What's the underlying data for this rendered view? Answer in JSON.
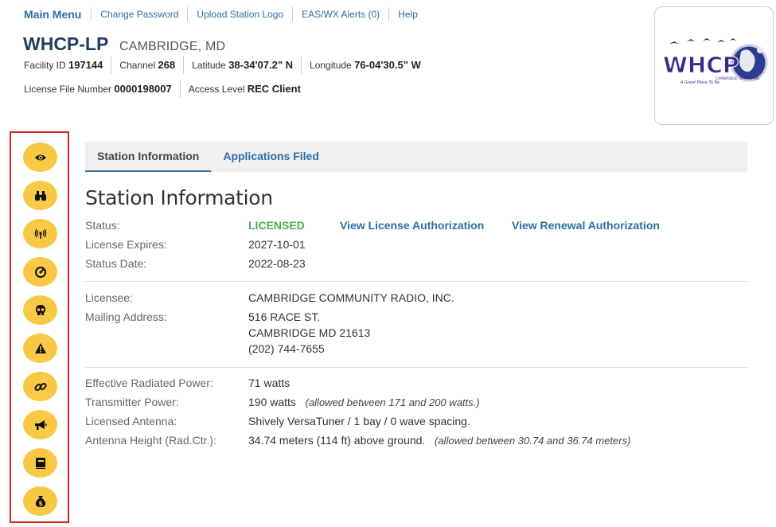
{
  "nav": {
    "main_menu": "Main Menu",
    "change_password": "Change Password",
    "upload_logo": "Upload Station Logo",
    "eas_alerts": "EAS/WX Alerts (0)",
    "help": "Help"
  },
  "station": {
    "callsign": "WHCP-LP",
    "city": "CAMBRIDGE, MD",
    "facility_id_label": "Facility ID",
    "facility_id": "197144",
    "channel_label": "Channel",
    "channel": "268",
    "latitude_label": "Latitude",
    "latitude": "38-34'07.2\" N",
    "longitude_label": "Longitude",
    "longitude": "76-04'30.5\" W",
    "license_file_label": "License File Number",
    "license_file": "0000198007",
    "access_level_label": "Access Level",
    "access_level": "REC Client"
  },
  "logo": {
    "text": "WHCP",
    "subtext1": "CAMBRIDGE, MARYLAND",
    "subtext2": "A Great Place To Be"
  },
  "sidebar": {
    "icons": [
      "eye-icon",
      "binoculars-icon",
      "broadcast-icon",
      "gauge-icon",
      "skull-icon",
      "warning-icon",
      "link-icon",
      "megaphone-icon",
      "notebook-icon",
      "money-bag-icon"
    ],
    "accent": "#f9c845",
    "border": "#d3212a"
  },
  "tabs": {
    "station_info": "Station Information",
    "applications": "Applications Filed"
  },
  "section": {
    "title": "Station Information",
    "status_label": "Status:",
    "status_value": "LICENSED",
    "view_license": "View License Authorization",
    "view_renewal": "View Renewal Authorization",
    "expires_label": "License Expires:",
    "expires_value": "2027-10-01",
    "status_date_label": "Status Date:",
    "status_date_value": "2022-08-23",
    "licensee_label": "Licensee:",
    "licensee_value": "CAMBRIDGE COMMUNITY RADIO, INC.",
    "mailing_label": "Mailing Address:",
    "address_line1": "516 RACE ST.",
    "address_line2": "CAMBRIDGE MD 21613",
    "phone": "(202) 744-7655",
    "erp_label": "Effective Radiated Power:",
    "erp_value": "71 watts",
    "tx_power_label": "Transmitter Power:",
    "tx_power_value": "190 watts",
    "tx_power_note": "(allowed between 171 and 200 watts.)",
    "antenna_label": "Licensed Antenna:",
    "antenna_value": "Shively VersaTuner / 1 bay / 0 wave spacing.",
    "height_label": "Antenna Height (Rad.Ctr.):",
    "height_value": "34.74 meters (114 ft) above ground.",
    "height_note": "(allowed between 30.74 and 36.74 meters)"
  }
}
